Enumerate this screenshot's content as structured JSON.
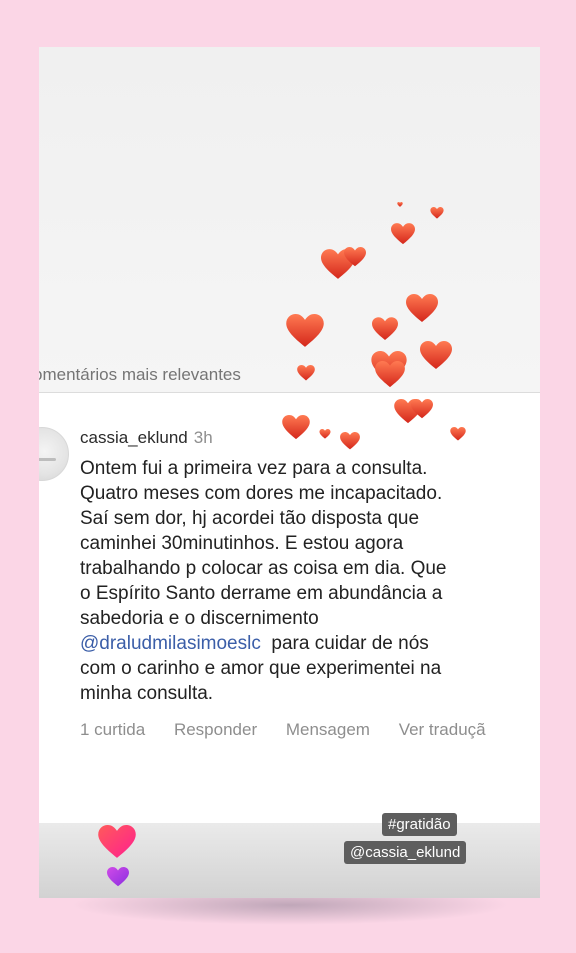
{
  "section_title": "omentários mais relevantes",
  "comment": {
    "username": "cassia_eklund",
    "time": "3h",
    "lines": [
      "Ontem fui a primeira vez para a consulta.",
      "Quatro meses com dores me incapacitado.",
      "Saí sem dor, hj acordei tão disposta que",
      "caminhei 30minutinhos. E estou agora",
      "trabalhando p colocar as coisa em dia. Que",
      "o Espírito Santo derrame em abundância a",
      "sabedoria e o discernimento"
    ],
    "mention": "@draludmilasimoeslc",
    "after_mention": "  para cuidar de nós",
    "lines_end": [
      "com o carinho e amor que experimentei na",
      "minha consulta."
    ]
  },
  "actions": {
    "likes": "1 curtida",
    "reply": "Responder",
    "message": "Mensagem",
    "translate": "Ver traduçã"
  },
  "stickers": {
    "hashtag": "#gratidão",
    "mention": "@cassia_eklund"
  },
  "colors": {
    "background": "#fbd6e6",
    "heart_red": "#e8452c",
    "mention_blue": "#3b5ea8",
    "heart_pink": "#ff2a6d",
    "heart_purple": "#b23ce0"
  }
}
